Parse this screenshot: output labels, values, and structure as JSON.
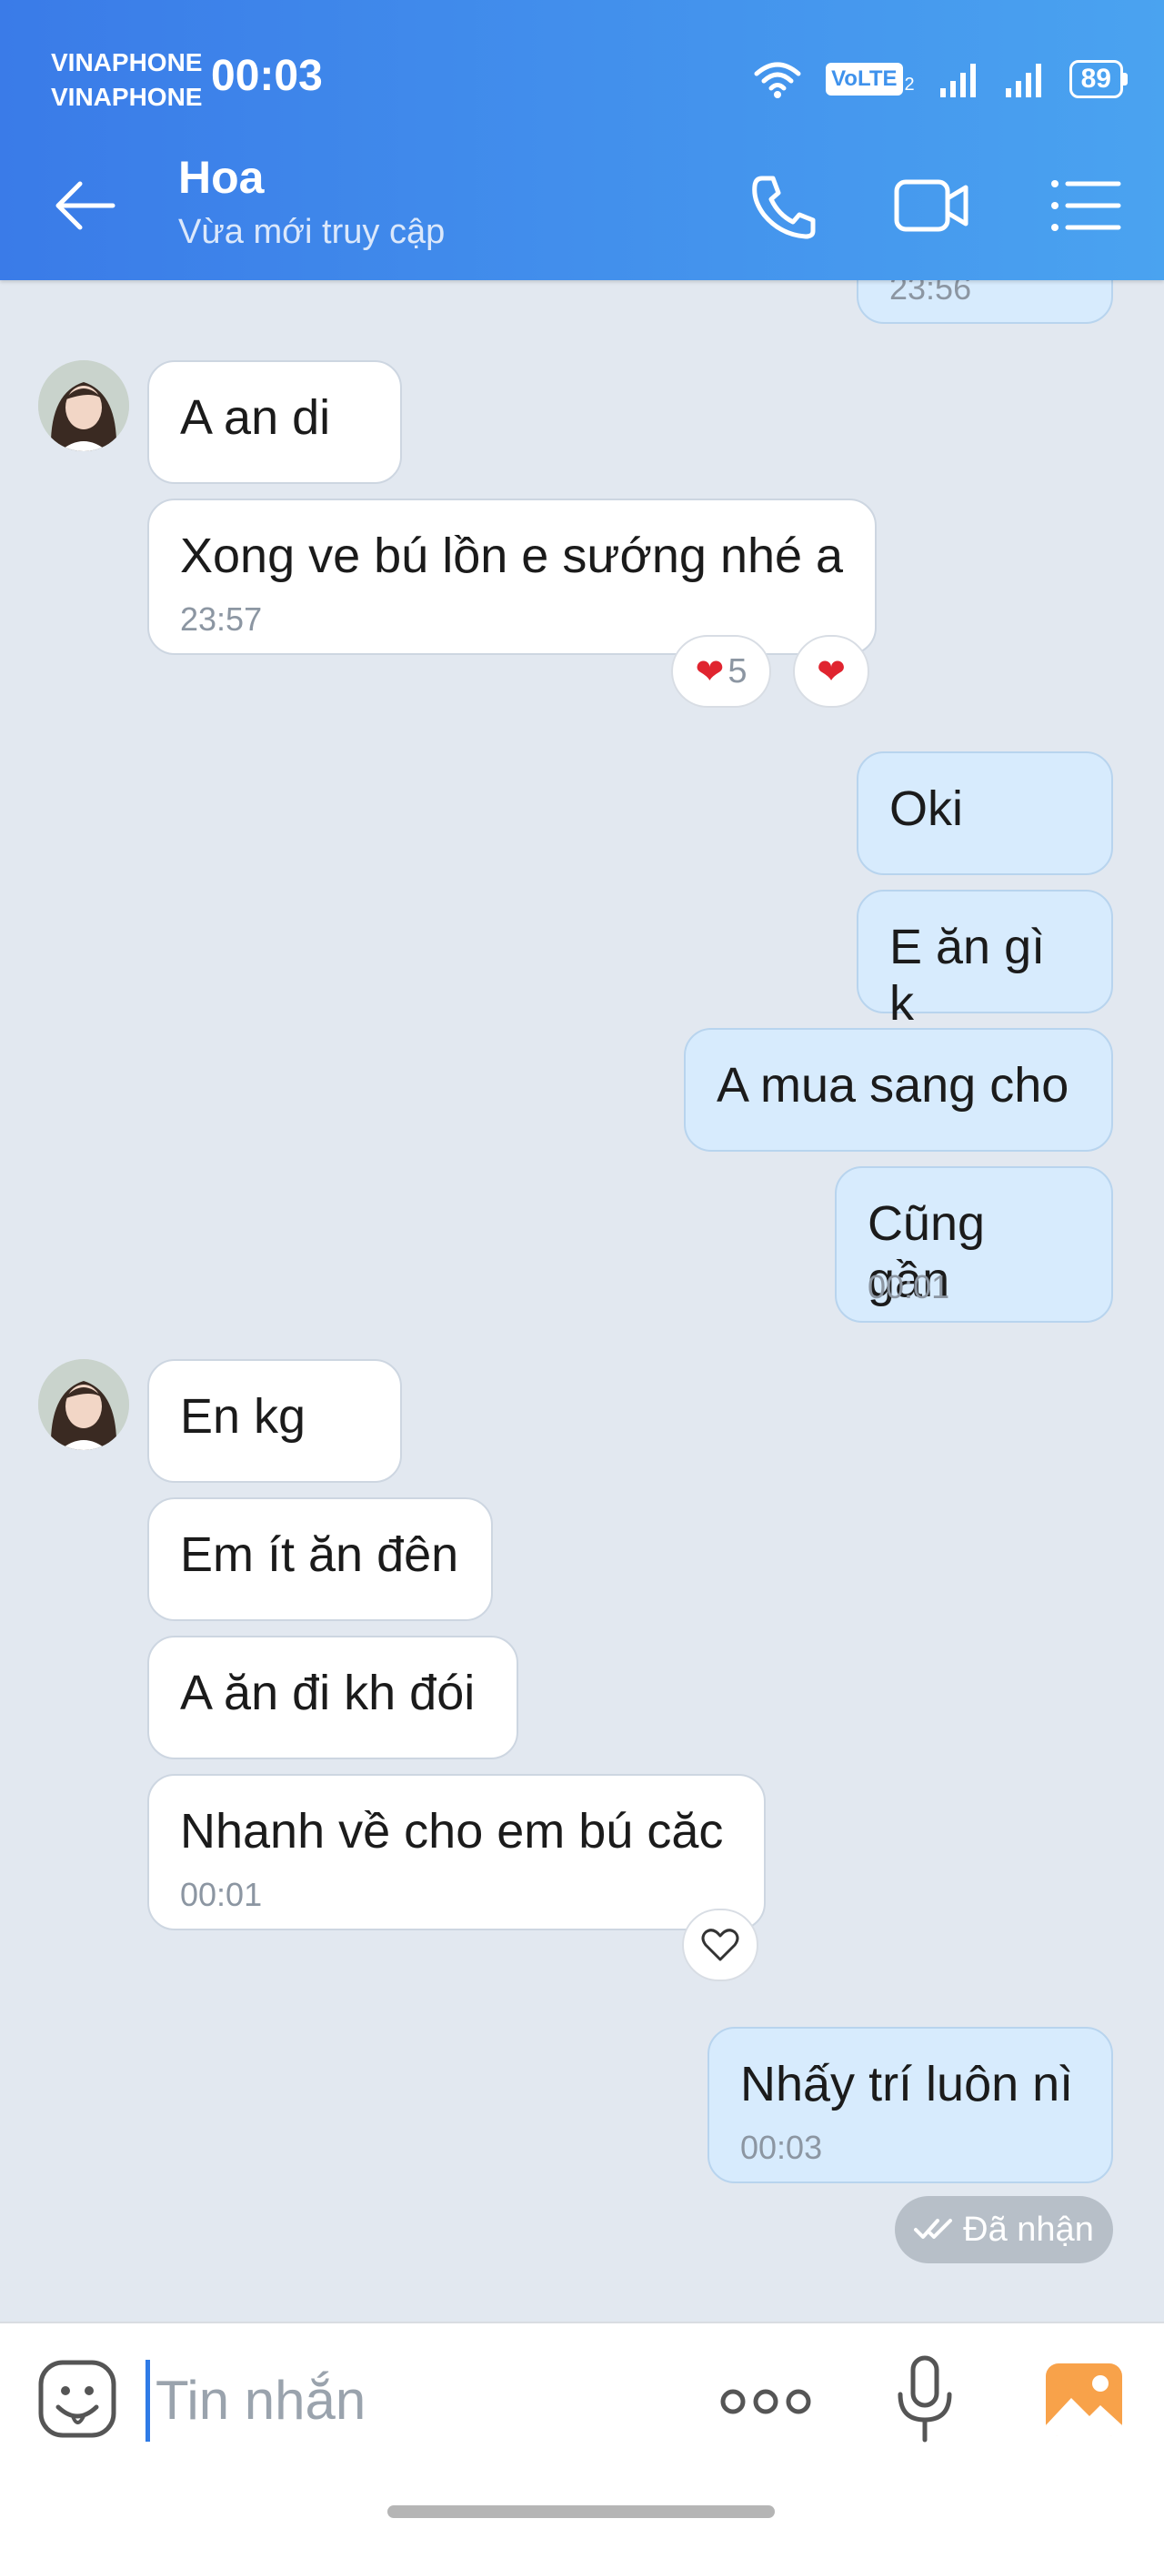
{
  "status_bar": {
    "carrier_1": "VINAPHONE",
    "carrier_2": "VINAPHONE",
    "time": "00:03",
    "volte": "VoLTE",
    "volte_sim": "2",
    "battery": "89"
  },
  "header": {
    "name": "Hoa",
    "status": "Vừa mới truy cập"
  },
  "messages": [
    {
      "dir": "out",
      "time": "23:56"
    },
    {
      "dir": "in",
      "text": "A an di"
    },
    {
      "dir": "in",
      "text": "Xong ve bú lồn e sướng nhé a",
      "time": "23:57",
      "reaction_count": "5"
    },
    {
      "dir": "out",
      "text": "Oki"
    },
    {
      "dir": "out",
      "text": "E ăn gì k"
    },
    {
      "dir": "out",
      "text": "A mua sang cho"
    },
    {
      "dir": "out",
      "text": "Cũng gần",
      "time": "00:01"
    },
    {
      "dir": "in",
      "text": "En kg"
    },
    {
      "dir": "in",
      "text": "Em ít ăn đên"
    },
    {
      "dir": "in",
      "text": "A ăn đi kh đói"
    },
    {
      "dir": "in",
      "text": "Nhanh về cho em bú căc",
      "time": "00:01"
    },
    {
      "dir": "out",
      "text": "Nhấy trí luôn nì",
      "time": "00:03"
    }
  ],
  "delivery_status": "Đã nhận",
  "composer": {
    "placeholder": "Tin nhắn"
  },
  "colors": {
    "header_start": "#3a7be8",
    "header_end": "#4aa3f0",
    "chat_bg": "#e2e8f0",
    "outgoing_bubble": "#d7ebfd",
    "incoming_bubble": "#ffffff",
    "reaction_heart": "#e0242f"
  }
}
